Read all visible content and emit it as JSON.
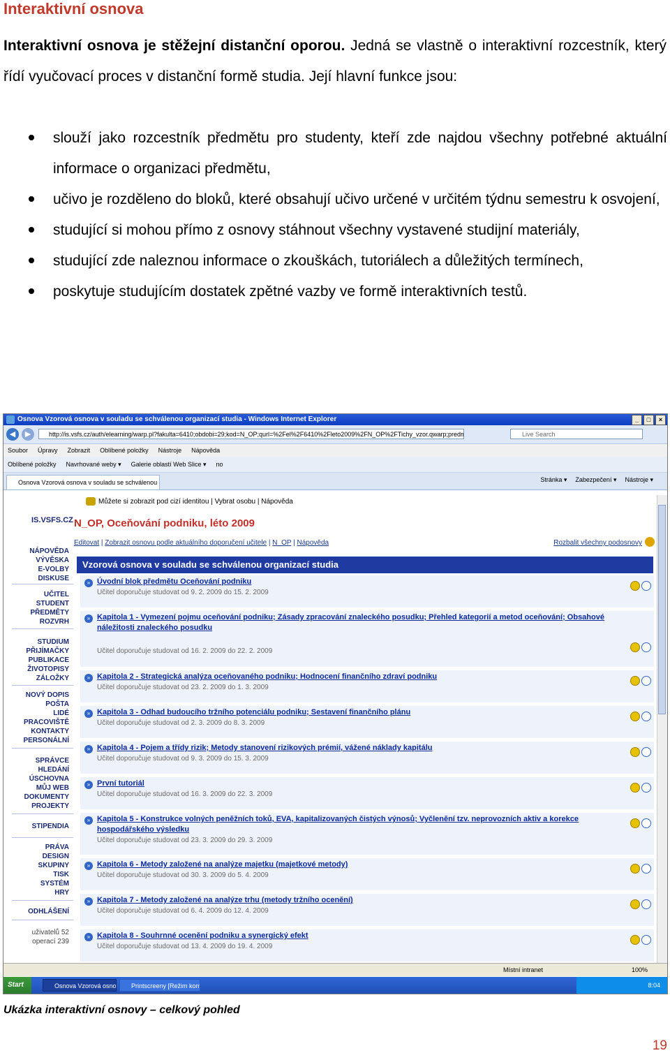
{
  "heading": "Interaktivní osnova",
  "intro": {
    "bold": "Interaktivní osnova je stěžejní distanční oporou.",
    "rest": " Jedná se vlastně o interaktivní rozcestník, který řídí vyučovací proces v distanční formě studia. Její hlavní funkce jsou:"
  },
  "bullets": [
    "slouží jako rozcestník předmětu pro studenty, kteří zde najdou všechny potřebné aktuální informace o organizaci předmětu,",
    "učivo je rozděleno do bloků, které obsahují učivo určené v určitém týdnu semestru k osvojení,",
    "studující si mohou přímo z osnovy stáhnout všechny vystavené studijní materiály,",
    "studující zde naleznou informace o zkouškách, tutoriálech a důležitých termínech,",
    "poskytuje studujícím dostatek zpětné vazby ve formě interaktivních testů."
  ],
  "screenshot": {
    "window_title": "Osnova Vzorová osnova v souladu se schválenou organizací studia - Windows Internet Explorer",
    "url": "http://is.vsfs.cz/auth/elearning/warp.pl?fakulta=6410;obdobi=29;kod=N_OP;qurl=%2Fel%2F6410%2Fleto2009%2FN_OP%2FTichy_vzor.qwarp;predmet=https",
    "search_placeholder": "Live Search",
    "menu": [
      "Soubor",
      "Úpravy",
      "Zobrazit",
      "Oblíbené položky",
      "Nástroje",
      "Nápověda"
    ],
    "favorites": [
      "Oblíbené položky",
      "Navrhované weby ▾",
      "Galerie oblastí Web Slice ▾",
      "no"
    ],
    "tab_label": "Osnova Vzorová osnova v souladu se schválenou org...",
    "commands": [
      "Stránka ▾",
      "Zabezpečení ▾",
      "Nástroje ▾"
    ],
    "identity_line": "Můžete si zobrazit pod cizí identitou | Vybrat osobu | Nápověda",
    "sidebar": {
      "logo": "IS.VSFS.CZ",
      "groups": [
        [
          "NÁPOVĚDA",
          "VÝVĚSKA",
          "E-VOLBY",
          "DISKUSE"
        ],
        [
          "UČITEL",
          "STUDENT",
          "PŘEDMĚTY",
          "ROZVRH"
        ],
        [
          "STUDIUM",
          "PŘIJÍMAČKY",
          "PUBLIKACE",
          "ŽIVOTOPISY",
          "ZÁLOŽKY"
        ],
        [
          "NOVÝ DOPIS",
          "POŠTA",
          "LIDÉ",
          "PRACOVIŠTĚ",
          "KONTAKTY",
          "PERSONÁLNÍ"
        ],
        [
          "SPRÁVCE",
          "HLEDÁNÍ",
          "ÚSCHOVNA",
          "MŮJ WEB",
          "DOKUMENTY",
          "PROJEKTY"
        ],
        [
          "STIPENDIA"
        ],
        [
          "PRÁVA",
          "DESIGN",
          "SKUPINY",
          "TISK",
          "SYSTÉM",
          "HRY"
        ],
        [
          "ODHLÁŠENÍ"
        ],
        [
          "uživatelů 52",
          "operací 239"
        ]
      ]
    },
    "course_title": "N_OP, Oceňování podniku, léto 2009",
    "links": [
      "Editovat",
      "Zobrazit osnovu podle aktuálního doporučení učitele",
      "N_OP",
      "Nápověda"
    ],
    "expand_all": "Rozbalit všechny podosnovy",
    "osnova_title": "Vzorová osnova v souladu se schválenou organizací studia",
    "rows": [
      {
        "title": "Úvodní blok předmětu Oceňování podniku",
        "date": "Učitel doporučuje studovat od 9. 2. 2009 do 15. 2. 2009"
      },
      {
        "title": "Kapitola 1 - Vymezení pojmu oceňování podniku; Zásady zpracování znaleckého posudku; Přehled kategorií a metod oceňování; Obsahové náležitosti znaleckého posudku",
        "date": "Učitel doporučuje studovat od 16. 2. 2009 do 22. 2. 2009"
      },
      {
        "title": "Kapitola 2 - Strategická analýza oceňovaného podniku; Hodnocení finančního zdraví podniku",
        "date": "Učitel doporučuje studovat od 23. 2. 2009 do 1. 3. 2009"
      },
      {
        "title": "Kapitola 3 - Odhad budoucího tržního potenciálu podniku; Sestavení finančního plánu",
        "date": "Učitel doporučuje studovat od 2. 3. 2009 do 8. 3. 2009"
      },
      {
        "title": "Kapitola 4 - Pojem a třídy rizik; Metody stanovení rizikových prémií, vážené náklady kapitálu",
        "date": "Učitel doporučuje studovat od 9. 3. 2009 do 15. 3. 2009"
      },
      {
        "title": "První tutoriál",
        "date": "Učitel doporučuje studovat od 16. 3. 2009 do 22. 3. 2009"
      },
      {
        "title": "Kapitola 5 - Konstrukce volných peněžních toků, EVA, kapitalizovaných čistých výnosů; Vyčlenění tzv. neprovozních aktiv a korekce hospodářského výsledku",
        "date": "Učitel doporučuje studovat od 23. 3. 2009 do 29. 3. 2009"
      },
      {
        "title": "Kapitola 6 - Metody založené na analýze majetku (majetkové metody)",
        "date": "Učitel doporučuje studovat od 30. 3. 2009 do 5. 4. 2009"
      },
      {
        "title": "Kapitola 7 - Metody založené na analýze trhu (metody tržního ocenění)",
        "date": "Učitel doporučuje studovat od 6. 4. 2009 do 12. 4. 2009"
      },
      {
        "title": "Kapitola 8 - Souhrnné ocenění podniku a synergický efekt",
        "date": "Učitel doporučuje studovat od 13. 4. 2009 do 19. 4. 2009"
      }
    ],
    "status_zone": "Místní intranet",
    "zoom": "100%",
    "start": "Start",
    "tasks": [
      "Osnova Vzorová osno...",
      "Printscreeny [Režim kom..."
    ],
    "clock": "8:04"
  },
  "caption": "Ukázka interaktivní osnovy – celkový pohled",
  "page_number": "19"
}
